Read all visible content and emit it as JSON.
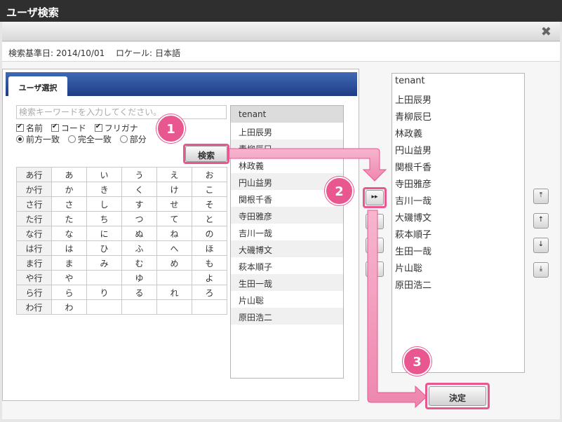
{
  "window": {
    "title": "ユーザ検索",
    "close_icon": "close-icon"
  },
  "info": {
    "base_date_label": "検索基準日:",
    "base_date": "2014/10/01",
    "locale_label": "ロケール:",
    "locale": "日本語"
  },
  "tab": {
    "label": "ユーザ選択"
  },
  "search": {
    "placeholder": "検索キーワードを入力してください。",
    "fields": [
      {
        "label": "名前",
        "checked": true
      },
      {
        "label": "コード",
        "checked": true
      },
      {
        "label": "フリガナ",
        "checked": true
      }
    ],
    "match_modes": [
      {
        "label": "前方一致",
        "selected": true
      },
      {
        "label": "完全一致",
        "selected": false
      },
      {
        "label": "部分",
        "selected": false
      }
    ],
    "button": "検索"
  },
  "kana_rows": [
    [
      "あ行",
      "あ",
      "い",
      "う",
      "え",
      "お"
    ],
    [
      "か行",
      "か",
      "き",
      "く",
      "け",
      "こ"
    ],
    [
      "さ行",
      "さ",
      "し",
      "す",
      "せ",
      "そ"
    ],
    [
      "た行",
      "た",
      "ち",
      "つ",
      "て",
      "と"
    ],
    [
      "な行",
      "な",
      "に",
      "ぬ",
      "ね",
      "の"
    ],
    [
      "は行",
      "は",
      "ひ",
      "ふ",
      "へ",
      "ほ"
    ],
    [
      "ま行",
      "ま",
      "み",
      "む",
      "め",
      "も"
    ],
    [
      "や行",
      "や",
      "",
      "ゆ",
      "",
      "よ"
    ],
    [
      "ら行",
      "ら",
      "り",
      "る",
      "れ",
      "ろ"
    ],
    [
      "わ行",
      "わ",
      "",
      "",
      "",
      ""
    ]
  ],
  "results": [
    "tenant",
    "上田辰男",
    "青柳辰巳",
    "林政義",
    "円山益男",
    "関根千香",
    "寺田雅彦",
    "吉川一哉",
    "大磯博文",
    "萩本順子",
    "生田一哉",
    "片山聡",
    "原田浩二"
  ],
  "selected": [
    "tenant",
    "上田辰男",
    "青柳辰巳",
    "林政義",
    "円山益男",
    "関根千香",
    "寺田雅彦",
    "吉川一哉",
    "大磯博文",
    "萩本順子",
    "生田一哉",
    "片山聡",
    "原田浩二"
  ],
  "transfer_buttons": {
    "add_all": "▸▸"
  },
  "order_buttons": [
    {
      "icon": "move-top-icon",
      "glyph": "⤒"
    },
    {
      "icon": "move-up-icon",
      "glyph": "↑"
    },
    {
      "icon": "move-down-icon",
      "glyph": "↓"
    },
    {
      "icon": "move-bottom-icon",
      "glyph": "⤓"
    }
  ],
  "confirm_button": "決定",
  "callouts": [
    "1",
    "2",
    "3"
  ],
  "accent_color": "#e8578f"
}
